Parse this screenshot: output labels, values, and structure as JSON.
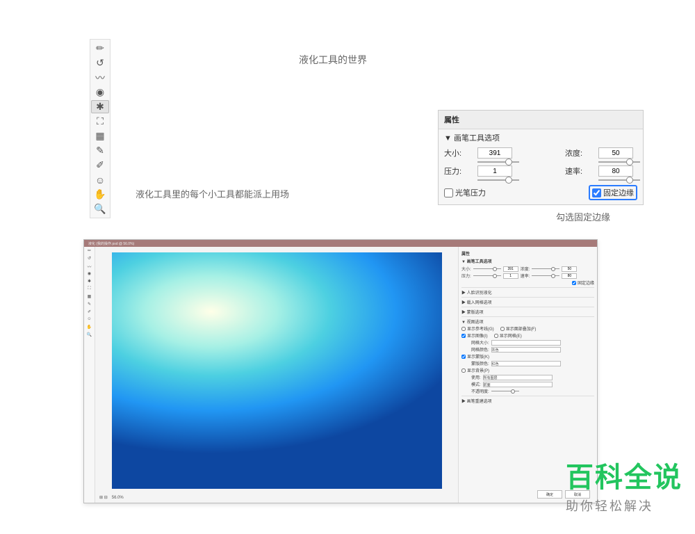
{
  "headings": {
    "main": "液化工具的世界",
    "sub": "液化工具里的每个小工具都能派上用场",
    "note": "勾选固定边缘"
  },
  "toolbar": {
    "tools": [
      {
        "name": "forward-warp-icon",
        "glyph": "✏"
      },
      {
        "name": "reconstruct-icon",
        "glyph": "↺"
      },
      {
        "name": "smooth-icon",
        "glyph": "〰"
      },
      {
        "name": "twirl-icon",
        "glyph": "◉"
      },
      {
        "name": "pucker-icon",
        "glyph": "✱"
      },
      {
        "name": "bloat-icon",
        "glyph": "⛶"
      },
      {
        "name": "push-left-icon",
        "glyph": "▦"
      },
      {
        "name": "freeze-mask-icon",
        "glyph": "✎"
      },
      {
        "name": "thaw-mask-icon",
        "glyph": "✐"
      },
      {
        "name": "face-icon",
        "glyph": "☺"
      },
      {
        "name": "hand-icon",
        "glyph": "✋"
      },
      {
        "name": "zoom-icon",
        "glyph": "🔍"
      }
    ],
    "selected_index": 4
  },
  "props": {
    "title": "属性",
    "section": "▼ 画笔工具选项",
    "labels": {
      "size": "大小:",
      "density": "浓度:",
      "pressure": "压力:",
      "rate": "速率:",
      "pen": "光笔压力",
      "edge": "固定边缘"
    },
    "values": {
      "size": "391",
      "density": "50",
      "pressure": "1",
      "rate": "80"
    },
    "pen_checked": false,
    "edge_checked": true
  },
  "shot": {
    "titlebar": "液化 (我的操作.psd @ 56.0%)",
    "zoom": "56.0%",
    "right": {
      "title": "属性",
      "section": "▼ 画笔工具选项",
      "labels": {
        "size": "大小:",
        "density": "浓度:",
        "pressure": "压力:",
        "rate": "速率:"
      },
      "values": {
        "size": "391",
        "density": "50",
        "pressure": "1",
        "rate": "80"
      },
      "edge": "固定边缘",
      "sections": {
        "face": "▶ 人脸识别液化",
        "mesh": "▶ 载入网格选项",
        "mask": "▶ 蒙版选项",
        "view": "▼ 视图选项",
        "recon": "▶ 画笔重建选项"
      },
      "view": {
        "guides": "显示参考线(G)",
        "face_overlay": "显示面部叠加(F)",
        "image": "显示图像(I)",
        "mesh": "显示网格(E)",
        "mesh_size_l": "网格大小:",
        "mesh_color_l": "网格颜色:",
        "mesh_color_v": "灰色",
        "mask": "显示蒙版(K)",
        "mask_color_l": "蒙版颜色:",
        "mask_color_v": "红色",
        "bg": "显示背景(P)",
        "use_l": "使用:",
        "use_v": "所有图层",
        "mode_l": "模式:",
        "mode_v": "前面",
        "opacity_l": "不透明度:"
      }
    },
    "buttons": {
      "ok": "确定",
      "cancel": "取消"
    }
  },
  "watermark": {
    "big": "百科全说",
    "small": "助你轻松解决"
  }
}
